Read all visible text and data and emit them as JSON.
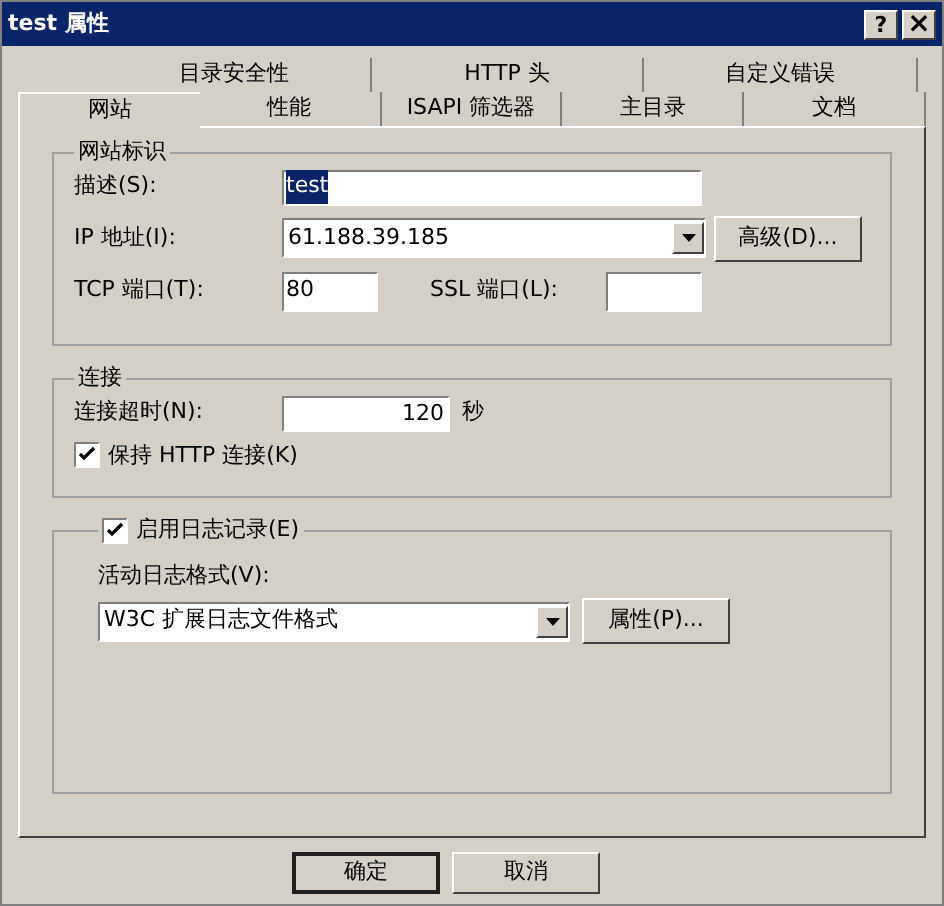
{
  "window": {
    "title": "test 属性",
    "buttons": [
      {
        "kind": "help",
        "label": "?"
      },
      {
        "kind": "close",
        "label": "×"
      }
    ]
  },
  "tab_rows": [
    {
      "tabs": [
        {
          "label": "目录安全性",
          "selected": false
        },
        {
          "label": "HTTP 头",
          "selected": false
        },
        {
          "label": "自定义错误",
          "selected": false
        }
      ]
    },
    {
      "tabs": [
        {
          "label": "网站",
          "selected": true
        },
        {
          "label": "性能",
          "selected": false
        },
        {
          "label": "ISAPI 筛选器",
          "selected": false
        },
        {
          "label": "主目录",
          "selected": false
        },
        {
          "label": "文档",
          "selected": false
        }
      ]
    }
  ],
  "site_identity": {
    "title": "网站标识",
    "description": {
      "label": "描述(S):",
      "value": "test",
      "selected": true
    },
    "ip": {
      "label": "IP 地址(I):",
      "value": "61.188.39.185"
    },
    "advanced_button": "高级(D)...",
    "tcp_port": {
      "label": "TCP 端口(T):",
      "value": "80"
    },
    "ssl_port": {
      "label": "SSL 端口(L):"
    }
  },
  "connection": {
    "title": "连接",
    "timeout": {
      "label": "连接超时(N):",
      "value": "120",
      "unit": "秒"
    },
    "keep_alive": {
      "label": "保持 HTTP 连接(K)",
      "checked": true
    }
  },
  "logging": {
    "label": "启用日志记录(E)",
    "checked": true,
    "format_label": "活动日志格式(V):",
    "format_value": "W3C 扩展日志文件格式",
    "properties_button": "属性(P)..."
  },
  "buttons": [
    {
      "label": "确定",
      "default": true
    },
    {
      "label": "取消",
      "default": false
    }
  ]
}
